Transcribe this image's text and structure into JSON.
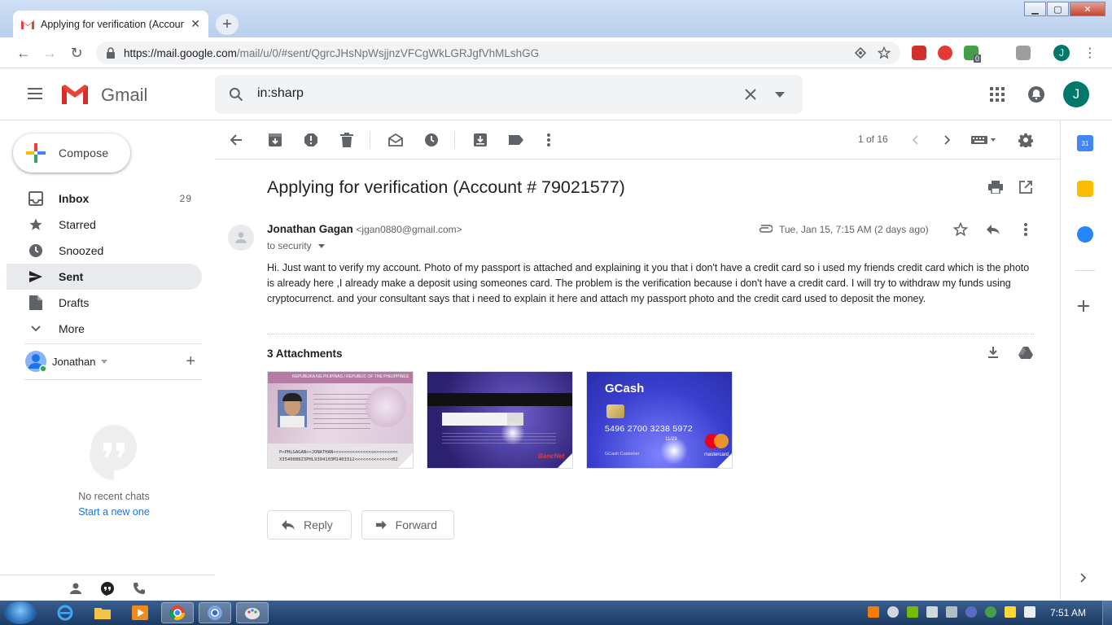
{
  "browser": {
    "tab_title": "Applying for verification (Accoun",
    "tab_close": "✕",
    "new_tab": "+",
    "url_host": "https://mail.google.com",
    "url_path": "/mail/u/0/#sent/QgrcJHsNpWsjjnzVFCgWkLGRJgfVhMLshGG",
    "profile_initial": "J",
    "ext_badge": "0"
  },
  "window_controls": {
    "minimize": "▁",
    "maximize": "▢",
    "close": "✕"
  },
  "header": {
    "product": "Gmail",
    "search_value": "in:sharp",
    "avatar_initial": "J"
  },
  "compose": {
    "label": "Compose"
  },
  "sidebar": {
    "items": [
      {
        "label": "Inbox",
        "count": "29",
        "bold": true,
        "active": false
      },
      {
        "label": "Starred",
        "count": "",
        "bold": false,
        "active": false
      },
      {
        "label": "Snoozed",
        "count": "",
        "bold": false,
        "active": false
      },
      {
        "label": "Sent",
        "count": "",
        "bold": true,
        "active": true
      },
      {
        "label": "Drafts",
        "count": "",
        "bold": false,
        "active": false
      },
      {
        "label": "More",
        "count": "",
        "bold": false,
        "active": false
      }
    ]
  },
  "hangouts": {
    "user": "Jonathan",
    "add": "+",
    "empty_title": "No recent chats",
    "empty_link": "Start a new one"
  },
  "toolbar": {
    "pager": "1 of 16"
  },
  "message": {
    "subject": "Applying for verification (Account # 79021577)",
    "sender_name": "Jonathan Gagan",
    "sender_email": "<jgan0880@gmail.com>",
    "to": "to security",
    "date": "Tue, Jan 15, 7:15 AM (2 days ago)",
    "body": "Hi. Just want to verify my account. Photo of my passport is attached and explaining it you that i don't have a credit card so i used my friends credit card which is the photo is already here ,I already make a deposit using someones card. The problem is the verification because i don't have a credit card. I will try to withdraw my funds using cryptocurrenct. and your consultant says that i need to explain it here and attach my passport photo and the credit card used to deposit the money.",
    "attachments_title": "3 Attachments",
    "attachments": [
      {
        "kind": "passport",
        "header": "REPUBLIKA NG PILIPINAS / REPUBLIC OF THE PHILIPPINES",
        "mrz1": "P<PHLGAGAN<<JONATHAN<<<<<<<<<<<<<<<<<<<<<<<<",
        "mrz2": "X3540088Z3PHL9304103M1403312<<<<<<<<<<<<<<02"
      },
      {
        "kind": "card-back",
        "brand": "BancNet"
      },
      {
        "kind": "card-front",
        "brand": "GCash",
        "number": "5496 2700 3238 5972",
        "holder": "GCash Customer",
        "expiry": "11/23",
        "network": "mastercard"
      }
    ]
  },
  "actions": {
    "reply": "Reply",
    "forward": "Forward"
  },
  "sidepanel": {
    "calendar_day": "31"
  },
  "taskbar": {
    "clock": "7:51 AM"
  },
  "colors": {
    "gmail_red": "#ea4335",
    "compose_blue": "#4285f4",
    "compose_green": "#34a853",
    "compose_yellow": "#fbbc04",
    "avatar": "#00796b",
    "link": "#1a73e8",
    "gcash_blue": "#3a3fcf"
  }
}
